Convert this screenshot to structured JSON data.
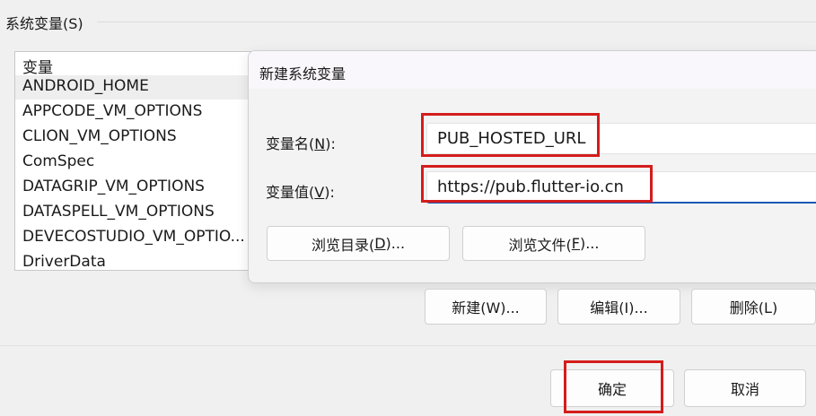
{
  "system_group": {
    "label": "系统变量(S)"
  },
  "variable_list": {
    "header": "变量",
    "rows": [
      "ANDROID_HOME",
      "APPCODE_VM_OPTIONS",
      "CLION_VM_OPTIONS",
      "ComSpec",
      "DATAGRIP_VM_OPTIONS",
      "DATASPELL_VM_OPTIONS",
      "DEVECOSTUDIO_VM_OPTIO...",
      "DriverData"
    ]
  },
  "dialog": {
    "title": "新建系统变量",
    "name_label": {
      "pre": "变量名(",
      "key": "N",
      "post": "):"
    },
    "value_label": {
      "pre": "变量值(",
      "key": "V",
      "post": "):"
    },
    "name_value": "PUB_HOSTED_URL",
    "value_value": "https://pub.flutter-io.cn",
    "browse_dir": {
      "pre": "浏览目录(",
      "key": "D",
      "post": ")..."
    },
    "browse_file": {
      "pre": "浏览文件(",
      "key": "F",
      "post": ")..."
    }
  },
  "list_buttons": {
    "new": "新建(W)...",
    "edit": "编辑(I)...",
    "delete": "删除(L)"
  },
  "footer": {
    "ok": "确定",
    "cancel": "取消"
  },
  "colors": {
    "highlight_box": "#d41c1c",
    "focus_underline": "#1a57b5"
  }
}
